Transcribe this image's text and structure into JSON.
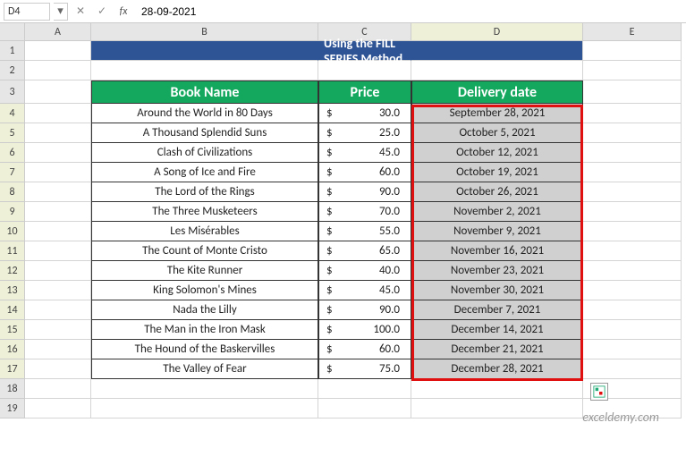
{
  "formula_bar": {
    "name_box": "D4",
    "formula": "28-09-2021"
  },
  "columns": [
    "A",
    "B",
    "C",
    "D",
    "E"
  ],
  "row_numbers": [
    "1",
    "2",
    "3",
    "4",
    "5",
    "6",
    "7",
    "8",
    "9",
    "10",
    "11",
    "12",
    "13",
    "14",
    "15",
    "16",
    "17",
    "18",
    "19"
  ],
  "title": "Using the FILL SERIES Method",
  "headers": {
    "book": "Book Name",
    "price": "Price",
    "date": "Delivery date"
  },
  "rows": [
    {
      "book": "Around the World in 80 Days",
      "cur": "$",
      "price": "30.0",
      "date": "September 28, 2021"
    },
    {
      "book": "A Thousand Splendid Suns",
      "cur": "$",
      "price": "25.0",
      "date": "October 5, 2021"
    },
    {
      "book": "Clash of Civilizations",
      "cur": "$",
      "price": "45.0",
      "date": "October 12, 2021"
    },
    {
      "book": "A Song of Ice and Fire",
      "cur": "$",
      "price": "60.0",
      "date": "October 19, 2021"
    },
    {
      "book": "The Lord of the Rings",
      "cur": "$",
      "price": "90.0",
      "date": "October 26, 2021"
    },
    {
      "book": "The Three Musketeers",
      "cur": "$",
      "price": "70.0",
      "date": "November 2, 2021"
    },
    {
      "book": "Les Misérables",
      "cur": "$",
      "price": "55.0",
      "date": "November 9, 2021"
    },
    {
      "book": "The Count of Monte Cristo",
      "cur": "$",
      "price": "65.0",
      "date": "November 16, 2021"
    },
    {
      "book": "The Kite Runner",
      "cur": "$",
      "price": "40.0",
      "date": "November 23, 2021"
    },
    {
      "book": "King Solomon's Mines",
      "cur": "$",
      "price": "45.0",
      "date": "November 30, 2021"
    },
    {
      "book": "Nada the Lilly",
      "cur": "$",
      "price": "90.0",
      "date": "December 7, 2021"
    },
    {
      "book": "The Man in the Iron Mask",
      "cur": "$",
      "price": "100.0",
      "date": "December 14, 2021"
    },
    {
      "book": "The Hound of the Baskervilles",
      "cur": "$",
      "price": "60.0",
      "date": "December 21, 2021"
    },
    {
      "book": "The Valley of Fear",
      "cur": "$",
      "price": "75.0",
      "date": "December 28, 2021"
    }
  ],
  "watermark": "exceldemy.com"
}
